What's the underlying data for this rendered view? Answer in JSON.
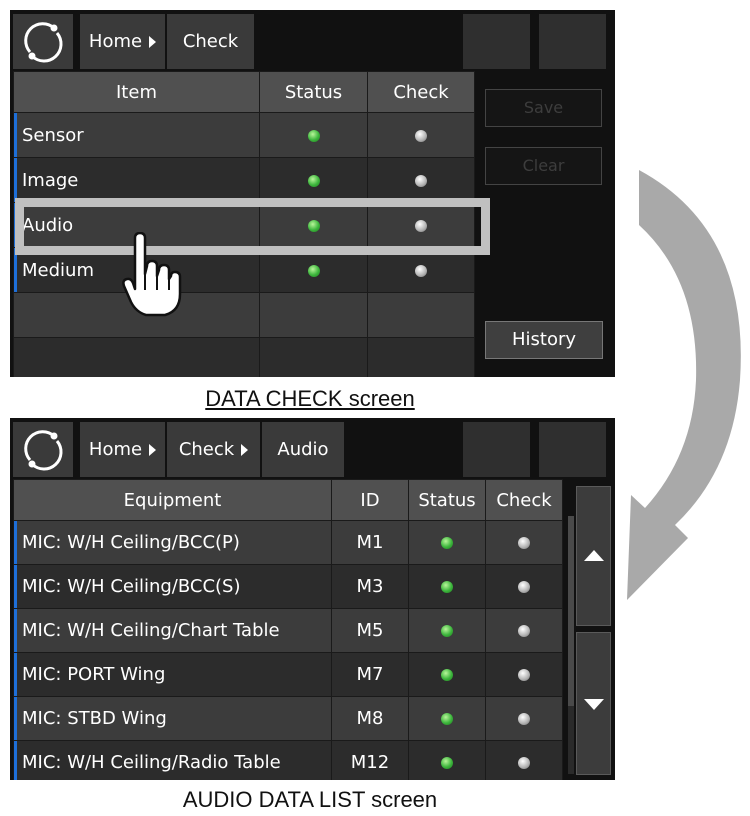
{
  "data_check": {
    "breadcrumb": [
      {
        "label": "Home",
        "has_arrow": true
      },
      {
        "label": "Check",
        "has_arrow": false
      }
    ],
    "columns": [
      "Item",
      "Status",
      "Check"
    ],
    "rows": [
      {
        "item": "Sensor",
        "status": "green",
        "check": "gray"
      },
      {
        "item": "Image",
        "status": "green",
        "check": "gray"
      },
      {
        "item": "Audio",
        "status": "green",
        "check": "gray"
      },
      {
        "item": "Medium",
        "status": "green",
        "check": "gray"
      },
      {
        "item": "",
        "status": "",
        "check": ""
      },
      {
        "item": "",
        "status": "",
        "check": ""
      }
    ],
    "buttons": {
      "save": "Save",
      "clear": "Clear",
      "history": "History"
    },
    "caption": "DATA CHECK screen"
  },
  "audio_list": {
    "breadcrumb": [
      {
        "label": "Home",
        "has_arrow": true
      },
      {
        "label": "Check",
        "has_arrow": true
      },
      {
        "label": "Audio",
        "has_arrow": false
      }
    ],
    "columns": [
      "Equipment",
      "ID",
      "Status",
      "Check"
    ],
    "rows": [
      {
        "equipment": "MIC: W/H Ceiling/BCC(P)",
        "id": "M1",
        "status": "green",
        "check": "gray"
      },
      {
        "equipment": "MIC: W/H Ceiling/BCC(S)",
        "id": "M3",
        "status": "green",
        "check": "gray"
      },
      {
        "equipment": "MIC: W/H Ceiling/Chart Table",
        "id": "M5",
        "status": "green",
        "check": "gray"
      },
      {
        "equipment": "MIC: PORT Wing",
        "id": "M7",
        "status": "green",
        "check": "gray"
      },
      {
        "equipment": "MIC: STBD Wing",
        "id": "M8",
        "status": "green",
        "check": "gray"
      },
      {
        "equipment": "MIC: W/H Ceiling/Radio Table",
        "id": "M12",
        "status": "green",
        "check": "gray"
      }
    ],
    "caption": "AUDIO DATA LIST screen"
  },
  "colors": {
    "accent": "#1e6fd9",
    "status_green": "#3cb53c",
    "check_gray": "#b7b7b7",
    "highlight": "#c0c0c0"
  },
  "icons": [
    "app-logo-icon",
    "breadcrumb-arrow-icon",
    "touch-hand-icon",
    "curved-arrow-icon",
    "scroll-up-icon",
    "scroll-down-icon"
  ]
}
